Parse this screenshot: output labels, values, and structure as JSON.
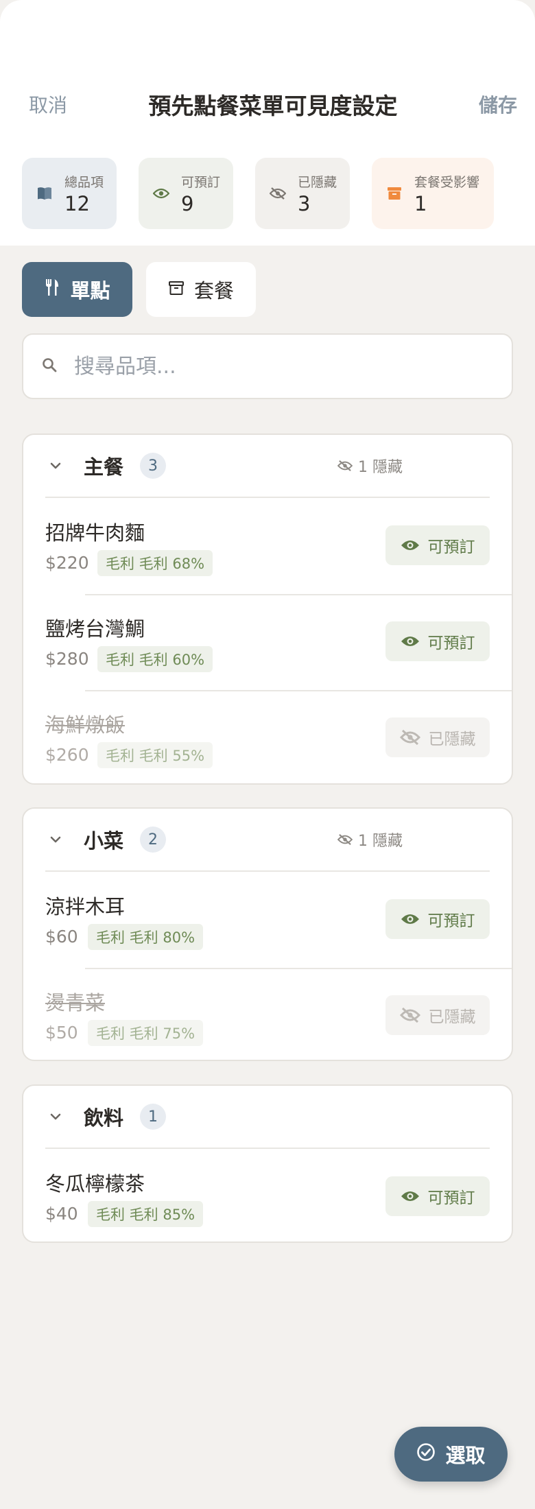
{
  "header": {
    "cancel_label": "取消",
    "title": "預先點餐菜單可見度設定",
    "save_label": "儲存"
  },
  "stats": [
    {
      "label": "總品項",
      "value": "12",
      "icon": "book-icon"
    },
    {
      "label": "可預訂",
      "value": "9",
      "icon": "eye-icon"
    },
    {
      "label": "已隱藏",
      "value": "3",
      "icon": "eye-off-icon"
    },
    {
      "label": "套餐受影響",
      "value": "1",
      "icon": "archive-icon"
    }
  ],
  "tabs": [
    {
      "label": "單點",
      "icon": "utensils-icon",
      "active": true
    },
    {
      "label": "套餐",
      "icon": "archive-icon",
      "active": false
    }
  ],
  "search": {
    "placeholder": "搜尋品項..."
  },
  "categories": [
    {
      "name": "主餐",
      "count": "3",
      "hidden_note": "1 隱藏",
      "items": [
        {
          "name": "招牌牛肉麵",
          "price": "$220",
          "margin": "毛利 毛利 68%",
          "status": "可預訂",
          "visible": true
        },
        {
          "name": "鹽烤台灣鯛",
          "price": "$280",
          "margin": "毛利 毛利 60%",
          "status": "可預訂",
          "visible": true
        },
        {
          "name": "海鮮燉飯",
          "price": "$260",
          "margin": "毛利 毛利 55%",
          "status": "已隱藏",
          "visible": false
        }
      ]
    },
    {
      "name": "小菜",
      "count": "2",
      "hidden_note": "1 隱藏",
      "items": [
        {
          "name": "涼拌木耳",
          "price": "$60",
          "margin": "毛利 毛利 80%",
          "status": "可預訂",
          "visible": true
        },
        {
          "name": "燙青菜",
          "price": "$50",
          "margin": "毛利 毛利 75%",
          "status": "已隱藏",
          "visible": false
        }
      ]
    },
    {
      "name": "飲料",
      "count": "1",
      "hidden_note": "",
      "items": [
        {
          "name": "冬瓜檸檬茶",
          "price": "$40",
          "margin": "毛利 毛利 85%",
          "status": "可預訂",
          "visible": true
        }
      ]
    }
  ],
  "fab": {
    "label": "選取",
    "icon": "check-circle-icon"
  },
  "colors": {
    "primary": "#4e6a80",
    "green": "#5f7a48",
    "orange": "#f08a3e"
  }
}
